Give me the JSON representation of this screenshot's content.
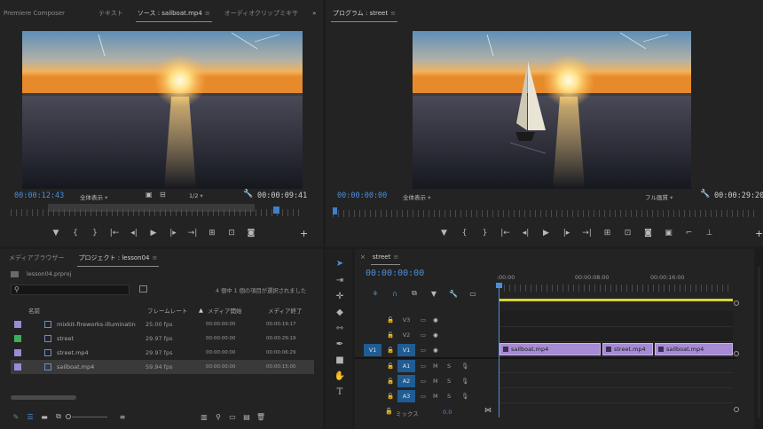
{
  "source_panel": {
    "tabs": [
      "Premiere Composer",
      "テキスト",
      "ソース : sailboat.mp4",
      "オーディオクリップミキサ"
    ],
    "active_tab_index": 2,
    "timecode_current": "00:00:12:43",
    "fit_label": "全体表示",
    "resolution_label": "1/2",
    "timecode_duration": "00:00:09:41"
  },
  "program_panel": {
    "tab_label": "プログラム : street",
    "timecode_current": "00:00:00:00",
    "fit_label": "全体表示",
    "quality_label": "フル画質",
    "timecode_duration": "00:00:29:20"
  },
  "project_panel": {
    "tabs": [
      "メディアブラウザー",
      "プロジェクト : lesson04"
    ],
    "active_tab_index": 1,
    "project_file": "lesson04.prproj",
    "search_placeholder": "",
    "selection_status": "4 個中 1 個の項目が選択されました",
    "columns": [
      "名前",
      "フレームレート",
      "メディア開始",
      "メディア終了"
    ],
    "items": [
      {
        "color": "#9b8ad8",
        "icon": "sequence-icon",
        "name": "mixkit-fireworks-illuminatin",
        "fps": "25.00 fps",
        "start": "00:00:00:00",
        "end": "00:00:19:17"
      },
      {
        "color": "#3cae5a",
        "icon": "sequence-icon",
        "name": "street",
        "fps": "29.97 fps",
        "start": "00:00:00:00",
        "end": "00:00:29:19"
      },
      {
        "color": "#9b8ad8",
        "icon": "clip-icon",
        "name": "street.mp4",
        "fps": "29.97 fps",
        "start": "00:00:00:00",
        "end": "00:00:06:29"
      },
      {
        "color": "#9b8ad8",
        "icon": "clip-icon",
        "name": "sailboat.mp4",
        "fps": "59.94 fps",
        "start": "00:00:00:00",
        "end": "00:00:15:00"
      }
    ],
    "selected_index": 3
  },
  "timeline_panel": {
    "tab_label": "street",
    "timecode": "00:00:00:00",
    "ruler_labels": [
      ":00:00",
      "00:00:08:00",
      "00:00:16:00"
    ],
    "video_tracks": [
      "V3",
      "V2",
      "V1"
    ],
    "source_patch": "V1",
    "audio_tracks": [
      "A1",
      "A2",
      "A3"
    ],
    "mix_label": "ミックス",
    "mix_value": "0.0",
    "clips": [
      {
        "name": "sailboat.mp4"
      },
      {
        "name": "street.mp4"
      },
      {
        "name": "sailboat.mp4"
      }
    ]
  }
}
